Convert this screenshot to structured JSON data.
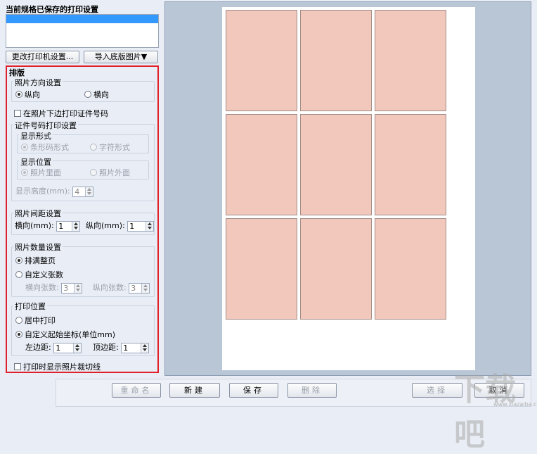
{
  "saved": {
    "title": "当前规格已保存的打印设置"
  },
  "top_buttons": {
    "printer": "更改打印机设置...",
    "import": "导入底版图片▼"
  },
  "layout": {
    "title": "排版",
    "orientation": {
      "label": "照片方向设置",
      "portrait": "纵向",
      "landscape": "横向",
      "selected": "portrait"
    },
    "print_id_checkbox": "在照片下边打印证件号码",
    "id_print": {
      "label": "证件号码打印设置",
      "display_form": {
        "label": "显示形式",
        "barcode": "条形码形式",
        "text": "字符形式"
      },
      "display_position": {
        "label": "显示位置",
        "inside": "照片里面",
        "outside": "照片外面"
      },
      "height_label": "显示高度(mm):",
      "height_value": "4"
    },
    "spacing": {
      "label": "照片间距设置",
      "h_label": "横向(mm):",
      "h_value": "1",
      "v_label": "纵向(mm):",
      "v_value": "1"
    },
    "count": {
      "label": "照片数量设置",
      "fill": "排满整页",
      "custom": "自定义张数",
      "h_label": "横向张数:",
      "h_value": "3",
      "v_label": "纵向张数:",
      "v_value": "3"
    },
    "position": {
      "label": "打印位置",
      "center": "居中打印",
      "custom": "自定义起始坐标(单位mm)",
      "left_label": "左边距:",
      "left_value": "1",
      "top_label": "顶边距:",
      "top_value": "1"
    },
    "cutline_checkbox": "打印时显示照片裁切线"
  },
  "preview": {
    "rows": 3,
    "cols": 3
  },
  "bottom": {
    "rename": "重命名",
    "new": "新建",
    "save": "保存",
    "delete": "删除",
    "select": "选择",
    "cancel": "取消"
  },
  "colors": {
    "accent_red": "#e0202a",
    "photo_fill": "#f2c7bc",
    "preview_bg": "#b9c6d6"
  },
  "watermark": {
    "main": "下载吧",
    "sub": "www.xiazaiba.com"
  }
}
